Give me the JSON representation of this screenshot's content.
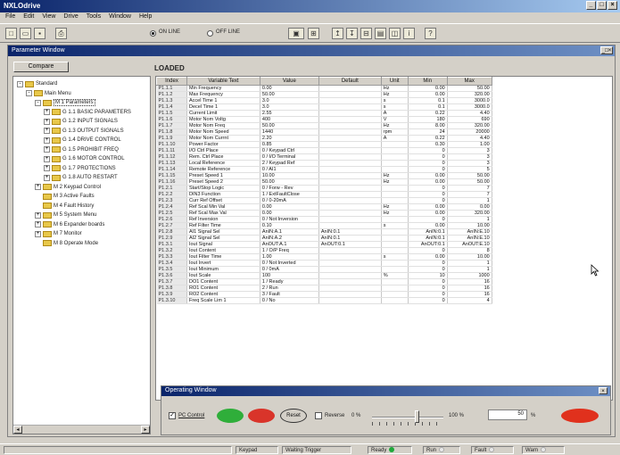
{
  "app": {
    "title": "NXLOdrive"
  },
  "menu": [
    "File",
    "Edit",
    "View",
    "Drive",
    "Tools",
    "Window",
    "Help"
  ],
  "toolbar": {
    "radio_online": "ON LINE",
    "radio_offline": "OFF LINE",
    "radio_selected": "online"
  },
  "param_window": {
    "title": "Parameter Window",
    "compare_label": "Compare",
    "status_label": "LOADED"
  },
  "tree": [
    {
      "label": "Standard",
      "level": 0,
      "exp": "-",
      "folder": true
    },
    {
      "label": "Main Menu",
      "level": 1,
      "exp": "-",
      "folder": true
    },
    {
      "label": "M 1 Parameters",
      "level": 2,
      "exp": "-",
      "folder": true,
      "selected": true
    },
    {
      "label": "G 1.1 BASIC PARAMETERS",
      "level": 3,
      "exp": "+",
      "folder": true
    },
    {
      "label": "G 1.2 INPUT SIGNALS",
      "level": 3,
      "exp": "+",
      "folder": true
    },
    {
      "label": "G 1.3 OUTPUT SIGNALS",
      "level": 3,
      "exp": "+",
      "folder": true
    },
    {
      "label": "G 1.4 DRIVE CONTROL",
      "level": 3,
      "exp": "+",
      "folder": true
    },
    {
      "label": "G 1.5 PROHIBIT FREQ",
      "level": 3,
      "exp": "+",
      "folder": true
    },
    {
      "label": "G 1.6 MOTOR CONTROL",
      "level": 3,
      "exp": "+",
      "folder": true
    },
    {
      "label": "G 1.7 PROTECTIONS",
      "level": 3,
      "exp": "+",
      "folder": true
    },
    {
      "label": "G 1.8 AUTO RESTART",
      "level": 3,
      "exp": "+",
      "folder": true
    },
    {
      "label": "M 2 Keypad Control",
      "level": 2,
      "exp": "+",
      "folder": true
    },
    {
      "label": "M 3 Active Faults",
      "level": 2,
      "exp": "",
      "folder": true
    },
    {
      "label": "M 4 Fault History",
      "level": 2,
      "exp": "",
      "folder": true
    },
    {
      "label": "M 5 System Menu",
      "level": 2,
      "exp": "+",
      "folder": true
    },
    {
      "label": "M 6 Expander boards",
      "level": 2,
      "exp": "+",
      "folder": true
    },
    {
      "label": "M 7 Monitor",
      "level": 2,
      "exp": "+",
      "folder": true
    },
    {
      "label": "M 8 Operate Mode",
      "level": 2,
      "exp": "",
      "folder": true
    }
  ],
  "grid": {
    "headers": [
      "Index",
      "Variable Text",
      "Value",
      "Default",
      "Unit",
      "Min",
      "Max"
    ],
    "rows": [
      [
        "P1.1.1",
        "Min Frequency",
        "0.00",
        "",
        "Hz",
        "0.00",
        "50.00"
      ],
      [
        "P1.1.2",
        "Max Frequency",
        "50.00",
        "",
        "Hz",
        "0.00",
        "320.00"
      ],
      [
        "P1.1.3",
        "Accel Time 1",
        "3.0",
        "",
        "s",
        "0.1",
        "3000.0"
      ],
      [
        "P1.1.4",
        "Decel Time 1",
        "3.0",
        "",
        "s",
        "0.1",
        "3000.0"
      ],
      [
        "P1.1.5",
        "Current Limit",
        "2.55",
        "",
        "A",
        "0.22",
        "4.40"
      ],
      [
        "P1.1.6",
        "Motor Nom Voltg",
        "400",
        "",
        "V",
        "180",
        "690"
      ],
      [
        "P1.1.7",
        "Motor Nom Freq",
        "50.00",
        "",
        "Hz",
        "8.00",
        "320.00"
      ],
      [
        "P1.1.8",
        "Motor Nom Speed",
        "1440",
        "",
        "rpm",
        "24",
        "20000"
      ],
      [
        "P1.1.9",
        "Motor Nom Currnt",
        "2.20",
        "",
        "A",
        "0.22",
        "4.40"
      ],
      [
        "P1.1.10",
        "Power Factor",
        "0.85",
        "",
        "",
        "0.30",
        "1.00"
      ],
      [
        "P1.1.11",
        "I/O Ctrl Place",
        "0 / Keypad Ctrl",
        "",
        "",
        "0",
        "3"
      ],
      [
        "P1.1.12",
        "Rem. Ctrl Place",
        "0 / I/O Terminal",
        "",
        "",
        "0",
        "3"
      ],
      [
        "P1.1.13",
        "Local Reference",
        "2 / Keypad Ref",
        "",
        "",
        "0",
        "3"
      ],
      [
        "P1.1.14",
        "Remote Reference",
        "0 / AI1",
        "",
        "",
        "0",
        "5"
      ],
      [
        "P1.1.15",
        "Preset Speed 1",
        "10.00",
        "",
        "Hz",
        "0.00",
        "50.00"
      ],
      [
        "P1.1.16",
        "Preset Speed 2",
        "50.00",
        "",
        "Hz",
        "0.00",
        "50.00"
      ],
      [
        "P1.2.1",
        "Start/Stop Logic",
        "0 / Forw - Rev",
        "",
        "",
        "0",
        "7"
      ],
      [
        "P1.2.2",
        "DIN3 Function",
        "1 / ExtFaultClose",
        "",
        "",
        "0",
        "7"
      ],
      [
        "P1.2.3",
        "Curr Ref Offset",
        "0 / 0-20mA",
        "",
        "",
        "0",
        "1"
      ],
      [
        "P1.2.4",
        "Ref Scal Min Val",
        "0.00",
        "",
        "Hz",
        "0.00",
        "0.00"
      ],
      [
        "P1.2.5",
        "Ref Scal Max Val",
        "0.00",
        "",
        "Hz",
        "0.00",
        "320.00"
      ],
      [
        "P1.2.6",
        "Ref Inversion",
        "0 / Not Inversion",
        "",
        "",
        "0",
        "1"
      ],
      [
        "P1.2.7",
        "Ref Filter Time",
        "0.10",
        "",
        "s",
        "0.00",
        "10.00"
      ],
      [
        "P1.2.8",
        "AI1 Signal Sel",
        "AnIN:A.1",
        "AnIN:0.1",
        "",
        "AnIN:0.1",
        "AnIN:E.10"
      ],
      [
        "P1.2.9",
        "AI2 Signal Sel",
        "AnIN:A.2",
        "AnIN:0.1",
        "",
        "AnIN:0.1",
        "AnIN:E.10"
      ],
      [
        "P1.3.1",
        "Iout Signal",
        "AnOUT:A.1",
        "AnOUT:0.1",
        "",
        "AnOUT:0.1",
        "AnOUT:E.10"
      ],
      [
        "P1.3.2",
        "Iout Content",
        "1 / O/P Freq",
        "",
        "",
        "0",
        "8"
      ],
      [
        "P1.3.3",
        "Iout Filter Time",
        "1.00",
        "",
        "s",
        "0.00",
        "10.00"
      ],
      [
        "P1.3.4",
        "Iout Invert",
        "0 / Not Inverted",
        "",
        "",
        "0",
        "1"
      ],
      [
        "P1.3.5",
        "Iout Minimum",
        "0 / 0mA",
        "",
        "",
        "0",
        "1"
      ],
      [
        "P1.3.6",
        "Iout Scale",
        "100",
        "",
        "%",
        "10",
        "1000"
      ],
      [
        "P1.3.7",
        "DO1 Content",
        "1 / Ready",
        "",
        "",
        "0",
        "16"
      ],
      [
        "P1.3.8",
        "RO1 Content",
        "2 / Run",
        "",
        "",
        "0",
        "16"
      ],
      [
        "P1.3.9",
        "RO2 Content",
        "3 / Fault",
        "",
        "",
        "0",
        "16"
      ],
      [
        "P1.3.10",
        "Freq Scale Lim 1",
        "0 / No",
        "",
        "",
        "0",
        "4"
      ]
    ]
  },
  "operating_window": {
    "title": "Operating Window",
    "pc_control_label": "PC Control",
    "pc_control_checked": true,
    "reset_label": "Reset",
    "reverse_label": "Reverse",
    "reverse_value": "0 %",
    "slider_max": "100 %",
    "setpoint_value": "50",
    "setpoint_unit": "%",
    "colors": {
      "start": "#2fae3a",
      "stop": "#d9342a",
      "fault": "#e0311d"
    }
  },
  "statusbar": {
    "keypad": "Keypad",
    "mode": "Waiting Trigger",
    "ready": "Ready",
    "run": "Run",
    "fault": "Fault",
    "warn": "Warn"
  }
}
